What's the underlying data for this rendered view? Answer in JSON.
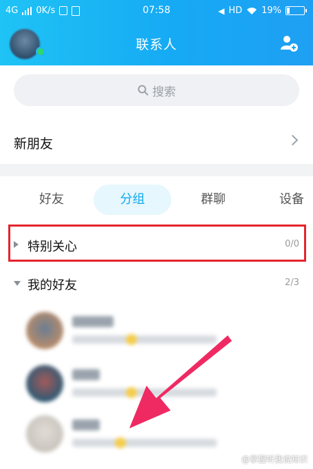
{
  "status_bar": {
    "network": "4G",
    "speed": "0K/s",
    "time": "07:58",
    "hd": "HD",
    "battery": "19%",
    "battery_level": 0.19
  },
  "header": {
    "title": "联系人"
  },
  "search": {
    "placeholder": "搜索"
  },
  "new_friends": {
    "label": "新朋友"
  },
  "tabs": [
    {
      "label": "好友"
    },
    {
      "label": "分组"
    },
    {
      "label": "群聊"
    },
    {
      "label": "设备"
    }
  ],
  "active_tab": "分组",
  "groups": [
    {
      "name": "特别关心",
      "count": "0/0"
    },
    {
      "name": "我的好友",
      "count": "2/3"
    }
  ],
  "watermark": "@掌握听我说知识",
  "colors": {
    "header_start": "#1fc3f5",
    "header_end": "#1f9ff3",
    "active_tab_text": "#13a9ee",
    "highlight_box": "#e5232c",
    "arrow": "#ef2a63"
  }
}
